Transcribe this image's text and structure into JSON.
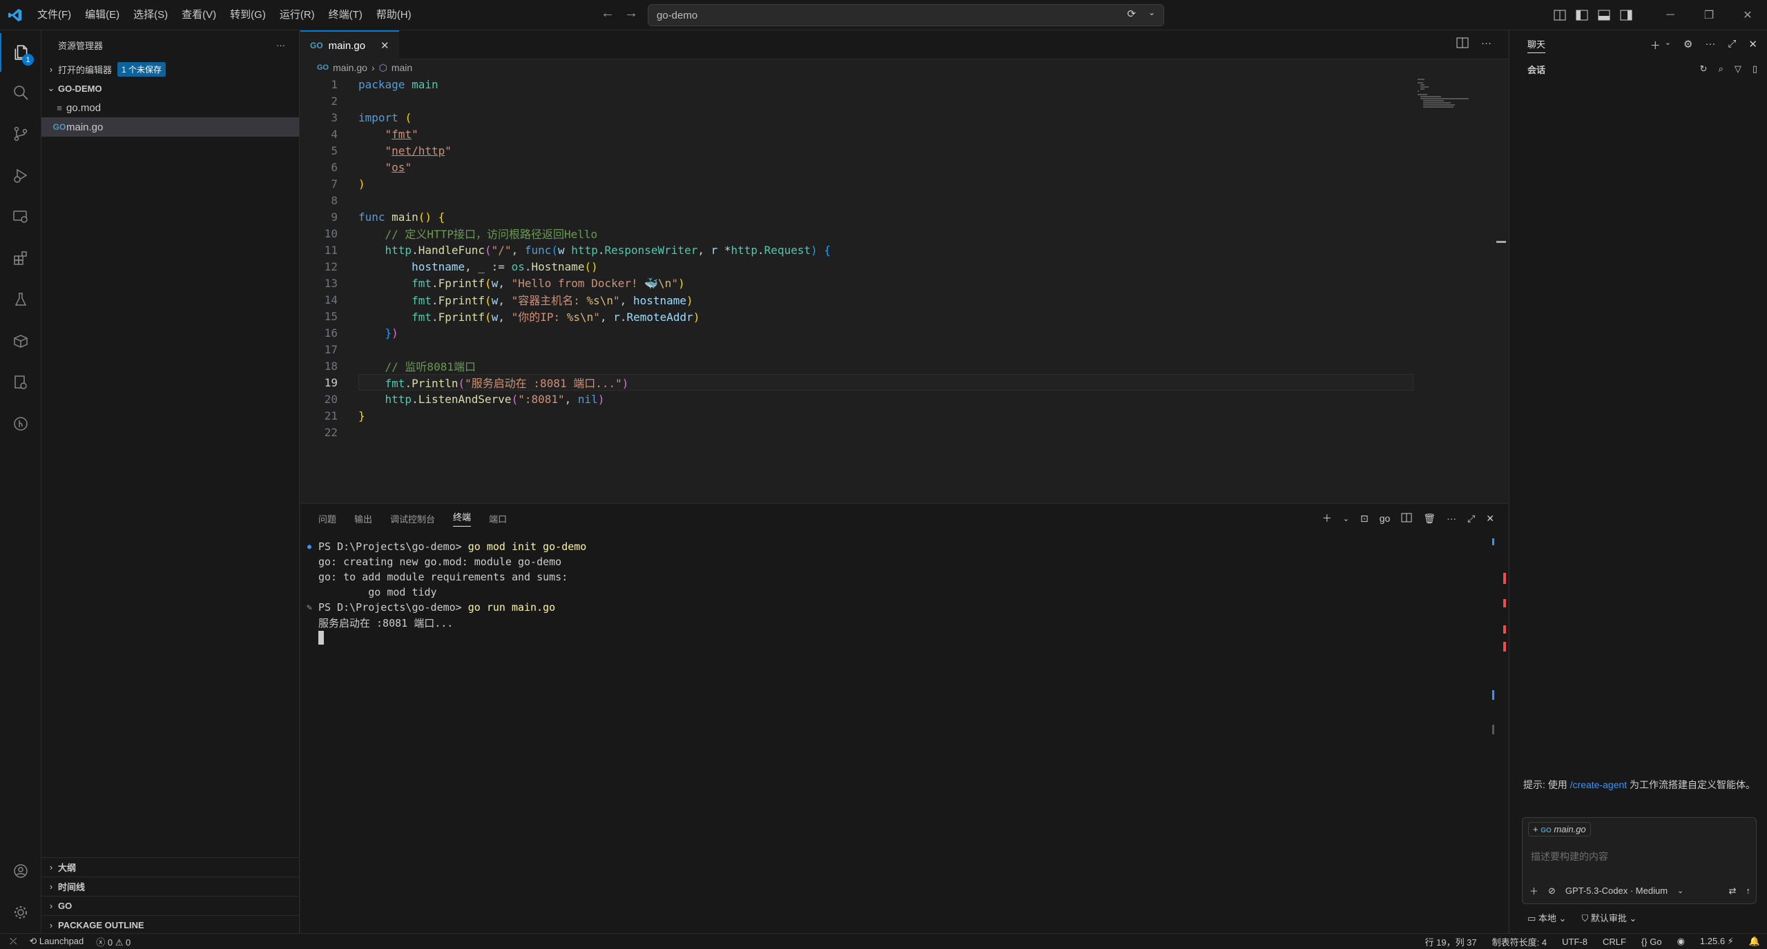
{
  "menu": [
    "文件(F)",
    "编辑(E)",
    "选择(S)",
    "查看(V)",
    "转到(G)",
    "运行(R)",
    "终端(T)",
    "帮助(H)"
  ],
  "command_center": {
    "text": "go-demo"
  },
  "activity": {
    "explorer_badge": "1"
  },
  "explorer": {
    "title": "资源管理器",
    "open_editors": "打开的编辑器",
    "unsaved": "1 个未保存",
    "folder": "GO-DEMO",
    "files": [
      {
        "name": "go.mod"
      },
      {
        "name": "main.go"
      }
    ],
    "outline": "大纲",
    "timeline": "时间线",
    "go": "GO",
    "package_outline": "PACKAGE OUTLINE"
  },
  "editor": {
    "tab_label": "main.go",
    "breadcrumb_file": "main.go",
    "breadcrumb_symbol": "main",
    "current_line": 19,
    "lines": [
      [
        [
          "kw",
          "package"
        ],
        [
          "pl",
          " "
        ],
        [
          "ty",
          "main"
        ]
      ],
      [],
      [
        [
          "kw",
          "import"
        ],
        [
          "pl",
          " "
        ],
        [
          "br1",
          "("
        ]
      ],
      [
        [
          "pl",
          "    "
        ],
        [
          "str",
          "\""
        ],
        [
          "str u",
          "fmt"
        ],
        [
          "str",
          "\""
        ]
      ],
      [
        [
          "pl",
          "    "
        ],
        [
          "str",
          "\""
        ],
        [
          "str u",
          "net/http"
        ],
        [
          "str",
          "\""
        ]
      ],
      [
        [
          "pl",
          "    "
        ],
        [
          "str",
          "\""
        ],
        [
          "str u",
          "os"
        ],
        [
          "str",
          "\""
        ]
      ],
      [
        [
          "br1",
          ")"
        ]
      ],
      [],
      [
        [
          "kw",
          "func"
        ],
        [
          "pl",
          " "
        ],
        [
          "fn",
          "main"
        ],
        [
          "br1",
          "()"
        ],
        [
          "pl",
          " "
        ],
        [
          "br1",
          "{"
        ]
      ],
      [
        [
          "pl",
          "    "
        ],
        [
          "cm",
          "// 定义HTTP接口，访问根路径返回Hello"
        ]
      ],
      [
        [
          "pl",
          "    "
        ],
        [
          "ty",
          "http"
        ],
        [
          "pl",
          "."
        ],
        [
          "fn",
          "HandleFunc"
        ],
        [
          "br2",
          "("
        ],
        [
          "str",
          "\"/\""
        ],
        [
          "pl",
          ", "
        ],
        [
          "kw",
          "func"
        ],
        [
          "br3",
          "("
        ],
        [
          "var",
          "w"
        ],
        [
          "pl",
          " "
        ],
        [
          "ty",
          "http"
        ],
        [
          "pl",
          "."
        ],
        [
          "ty",
          "ResponseWriter"
        ],
        [
          "pl",
          ", "
        ],
        [
          "var",
          "r"
        ],
        [
          "pl",
          " *"
        ],
        [
          "ty",
          "http"
        ],
        [
          "pl",
          "."
        ],
        [
          "ty",
          "Request"
        ],
        [
          "br3",
          ")"
        ],
        [
          "pl",
          " "
        ],
        [
          "br3",
          "{"
        ]
      ],
      [
        [
          "pl",
          "        "
        ],
        [
          "var",
          "hostname"
        ],
        [
          "pl",
          ", _ := "
        ],
        [
          "ty",
          "os"
        ],
        [
          "pl",
          "."
        ],
        [
          "fn",
          "Hostname"
        ],
        [
          "br1",
          "()"
        ]
      ],
      [
        [
          "pl",
          "        "
        ],
        [
          "ty",
          "fmt"
        ],
        [
          "pl",
          "."
        ],
        [
          "fn",
          "Fprintf"
        ],
        [
          "br1",
          "("
        ],
        [
          "var",
          "w"
        ],
        [
          "pl",
          ", "
        ],
        [
          "str",
          "\"Hello from Docker! 🐳"
        ],
        [
          "esc",
          "\\n"
        ],
        [
          "str",
          "\""
        ],
        [
          "br1",
          ")"
        ]
      ],
      [
        [
          "pl",
          "        "
        ],
        [
          "ty",
          "fmt"
        ],
        [
          "pl",
          "."
        ],
        [
          "fn",
          "Fprintf"
        ],
        [
          "br1",
          "("
        ],
        [
          "var",
          "w"
        ],
        [
          "pl",
          ", "
        ],
        [
          "str",
          "\"容器主机名: "
        ],
        [
          "esc",
          "%s\\n"
        ],
        [
          "str",
          "\""
        ],
        [
          "pl",
          ", "
        ],
        [
          "var",
          "hostname"
        ],
        [
          "br1",
          ")"
        ]
      ],
      [
        [
          "pl",
          "        "
        ],
        [
          "ty",
          "fmt"
        ],
        [
          "pl",
          "."
        ],
        [
          "fn",
          "Fprintf"
        ],
        [
          "br1",
          "("
        ],
        [
          "var",
          "w"
        ],
        [
          "pl",
          ", "
        ],
        [
          "str",
          "\"你的IP: "
        ],
        [
          "esc",
          "%s\\n"
        ],
        [
          "str",
          "\""
        ],
        [
          "pl",
          ", "
        ],
        [
          "var",
          "r"
        ],
        [
          "pl",
          "."
        ],
        [
          "var",
          "RemoteAddr"
        ],
        [
          "br1",
          ")"
        ]
      ],
      [
        [
          "pl",
          "    "
        ],
        [
          "br3",
          "}"
        ],
        [
          "br2",
          ")"
        ]
      ],
      [],
      [
        [
          "pl",
          "    "
        ],
        [
          "cm",
          "// 监听8081端口"
        ]
      ],
      [
        [
          "pl",
          "    "
        ],
        [
          "ty",
          "fmt"
        ],
        [
          "pl",
          "."
        ],
        [
          "fn",
          "Println"
        ],
        [
          "br2",
          "("
        ],
        [
          "str",
          "\"服务启动在 :8081 端口...\""
        ],
        [
          "br2",
          ")"
        ]
      ],
      [
        [
          "pl",
          "    "
        ],
        [
          "ty",
          "http"
        ],
        [
          "pl",
          "."
        ],
        [
          "fn",
          "ListenAndServe"
        ],
        [
          "br2",
          "("
        ],
        [
          "str",
          "\":8081\""
        ],
        [
          "pl",
          ", "
        ],
        [
          "kw",
          "nil"
        ],
        [
          "br2",
          ")"
        ]
      ],
      [
        [
          "br1",
          "}"
        ]
      ],
      []
    ]
  },
  "panel": {
    "tabs": [
      "问题",
      "输出",
      "调试控制台",
      "终端",
      "端口"
    ],
    "active_tab": 3,
    "shell_label": "go",
    "terminal": [
      {
        "mark": "dot",
        "prompt": "PS D:\\Projects\\go-demo> ",
        "cmd": "go mod init go-demo"
      },
      {
        "mark": "",
        "text": "go: creating new go.mod: module go-demo"
      },
      {
        "mark": "",
        "text": "go: to add module requirements and sums:"
      },
      {
        "mark": "",
        "text": "        go mod tidy"
      },
      {
        "mark": "sparkle",
        "prompt": "PS D:\\Projects\\go-demo> ",
        "cmd": "go run main.go"
      },
      {
        "mark": "",
        "text": "服务启动在 :8081 端口..."
      }
    ]
  },
  "chat": {
    "title": "聊天",
    "sessions": "会话",
    "hint_prefix": "提示: 使用 ",
    "hint_link": "/create-agent",
    "hint_suffix": " 为工作流搭建自定义智能体。",
    "context_file": "main.go",
    "placeholder": "描述要构建的内容",
    "model": "GPT-5.3-Codex · Medium",
    "location": "本地",
    "approval": "默认审批"
  },
  "status": {
    "launchpad": "Launchpad",
    "errors": "0",
    "warnings": "0",
    "position": "行 19，列 37",
    "tab_size": "制表符长度: 4",
    "encoding": "UTF-8",
    "eol": "CRLF",
    "language": "Go",
    "go_version": "1.25.6"
  },
  "colors": {
    "accent": "#0078d4",
    "background": "#1f1f1f",
    "sidebar": "#181818"
  }
}
